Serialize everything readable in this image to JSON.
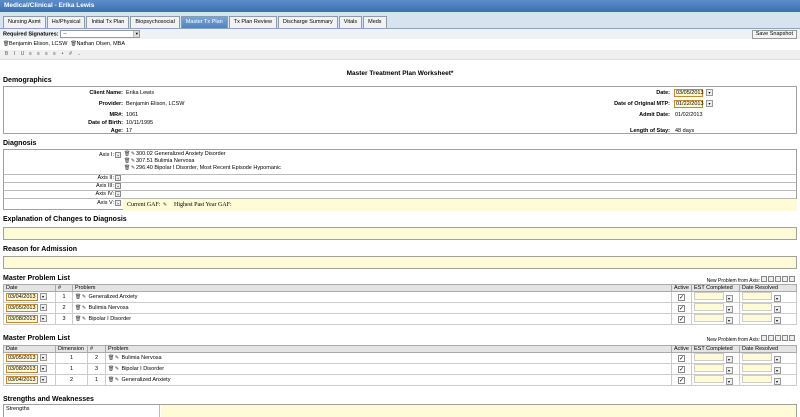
{
  "window": {
    "title": "Medical/Clinical - Erika Lewis"
  },
  "tabs": [
    {
      "label": "Nursing Asmt"
    },
    {
      "label": "Hx/Physical"
    },
    {
      "label": "Initial Tx Plan"
    },
    {
      "label": "Biopsychosocial"
    },
    {
      "label": "Master Tx Plan",
      "active": true
    },
    {
      "label": "Tx Plan Review"
    },
    {
      "label": "Discharge Summary"
    },
    {
      "label": "Vitals"
    },
    {
      "label": "Meds"
    }
  ],
  "signatures": {
    "label": "Required Signatures:",
    "selected": "--",
    "snapshot_button": "Save Snapshot",
    "signers": [
      "Benjamin Elison, LCSW",
      "Nathan Olsen, MBA"
    ]
  },
  "doc_title": "Master Treatment Plan Worksheet*",
  "demographics": {
    "heading": "Demographics",
    "client_name_label": "Client Name:",
    "client_name": "Erika Lewis",
    "provider_label": "Provider:",
    "provider": "Benjamin Elison, LCSW",
    "mr_label": "MR#:",
    "mr": "1061",
    "dob_label": "Date of Birth:",
    "dob": "10/11/1995",
    "age_label": "Age:",
    "age": "17",
    "date_label": "Date:",
    "date": "03/05/2013",
    "orig_mtp_label": "Date of Original MTP:",
    "orig_mtp": "01/22/2013",
    "admit_label": "Admit Date:",
    "admit": "01/02/2013",
    "los_label": "Length of Stay:",
    "los": "48 days"
  },
  "diagnosis": {
    "heading": "Diagnosis",
    "axis1_label": "Axis I:",
    "axis1_items": [
      "300.02 Generalized Anxiety Disorder",
      "307.51 Bulimia Nervosa",
      "296.40 Bipolar I Disorder, Most Recent Episode Hypomanic"
    ],
    "axis2_label": "Axis II:",
    "axis3_label": "Axis III:",
    "axis4_label": "Axis IV:",
    "axis5_label": "Axis V:",
    "gaf_current": "Current GAF:",
    "gaf_highest": "Highest Past Year GAF:"
  },
  "explanation_heading": "Explanation of Changes to Diagnosis",
  "reason_heading": "Reason for Admission",
  "problem_list_1": {
    "heading": "Master Problem List",
    "new_from_axis": "New Problem from Axis:",
    "columns": [
      "Date",
      "#",
      "Problem",
      "Active",
      "EST Completed",
      "Date Resolved"
    ],
    "rows": [
      {
        "date": "03/04/2013",
        "num": "1",
        "problem": "Generalized Anxiety"
      },
      {
        "date": "03/05/2013",
        "num": "2",
        "problem": "Bulimia Nervosa"
      },
      {
        "date": "03/08/2013",
        "num": "3",
        "problem": "Bipolar I Disorder"
      }
    ]
  },
  "problem_list_2": {
    "heading": "Master Problem List",
    "new_from_axis": "New Problem from Axis:",
    "columns": [
      "Date",
      "Dimension",
      "#",
      "Problem",
      "Active",
      "EST Completed",
      "Date Resolved"
    ],
    "rows": [
      {
        "date": "03/05/2013",
        "dimension": "1",
        "num": "2",
        "problem": "Bulimia Nervosa"
      },
      {
        "date": "03/08/2013",
        "dimension": "1",
        "num": "3",
        "problem": "Bipolar I Disorder"
      },
      {
        "date": "03/04/2013",
        "dimension": "2",
        "num": "1",
        "problem": "Generalized Anxiety"
      }
    ]
  },
  "strengths": {
    "heading": "Strengths and Weaknesses",
    "row_label": "Strengths"
  },
  "colors": {
    "titlebar": "#3c6fae",
    "active_tab": "#4e82c0",
    "field_bg": "#fffbd6"
  }
}
